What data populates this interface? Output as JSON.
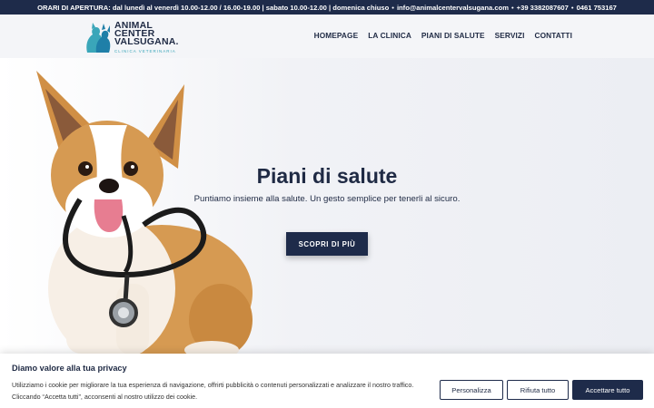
{
  "topbar": {
    "hours": "ORARI DI APERTURA: dal lunedì al venerdì 10.00-12.00 / 16.00-19.00 | sabato 10.00-12.00 | domenica chiuso",
    "email": "info@animalcentervalsugana.com",
    "phone1": "+39 3382087607",
    "phone2": "0461 753167",
    "separator": "•"
  },
  "logo": {
    "line1": "ANIMAL",
    "line2": "CENTER",
    "line3": "VALSUGANA.",
    "sub": "CLINICA VETERINARIA"
  },
  "nav": {
    "items": [
      "HOMEPAGE",
      "LA CLINICA",
      "PIANI DI SALUTE",
      "SERVIZI",
      "CONTATTI"
    ]
  },
  "hero": {
    "title": "Piani di salute",
    "subtitle": "Puntiamo insieme alla salute. Un gesto semplice per tenerli al sicuro.",
    "button": "SCOPRI DI PIÙ"
  },
  "cookie": {
    "title": "Diamo valore alla tua privacy",
    "text": "Utilizziamo i cookie per migliorare la tua esperienza di navigazione, offrirti pubblicità o contenuti personalizzati e analizzare il nostro traffico. Cliccando “Accetta tutti”, acconsenti al nostro utilizzo dei cookie.",
    "customize": "Personalizza",
    "reject": "Rifiuta tutto",
    "accept": "Accettare tutto"
  },
  "colors": {
    "navy": "#1e2b4a",
    "teal": "#3aa6b9",
    "background": "#f3f4f7"
  }
}
